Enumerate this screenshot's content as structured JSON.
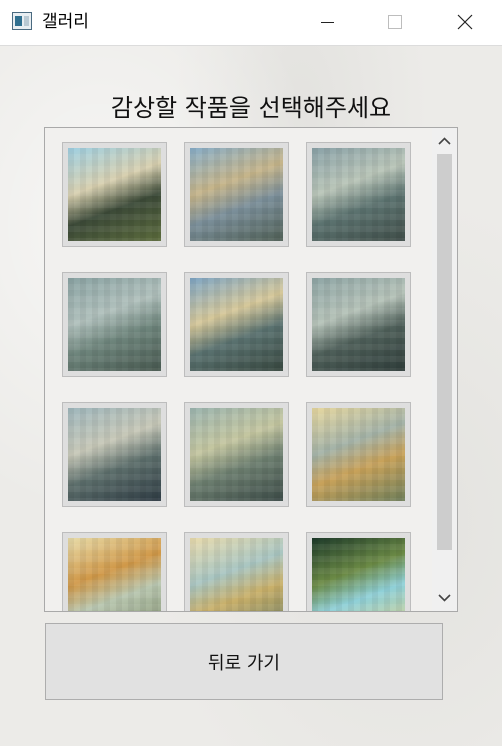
{
  "window": {
    "title": "갤러리",
    "controls": [
      "minimize-icon",
      "maximize-icon",
      "close-icon"
    ]
  },
  "heading": "감상할 작품을 선택해주세요",
  "thumbnails": [
    {
      "colors": [
        "#9fd0e2",
        "#3c4a38",
        "#d8d0b0",
        "#5b6b3c"
      ]
    },
    {
      "colors": [
        "#88aec9",
        "#7b8f9a",
        "#c6b58a",
        "#4f5f55"
      ]
    },
    {
      "colors": [
        "#8aa2a8",
        "#5c7370",
        "#b9c5b8",
        "#3f4d48"
      ]
    },
    {
      "colors": [
        "#8aa3a3",
        "#6e857c",
        "#b0c0bc",
        "#47584f"
      ]
    },
    {
      "colors": [
        "#7fa6c5",
        "#5a7270",
        "#d6c89a",
        "#37473f"
      ]
    },
    {
      "colors": [
        "#8fa6a6",
        "#4f605a",
        "#b5c2b8",
        "#2f3d3a"
      ]
    },
    {
      "colors": [
        "#9fb7bd",
        "#5d6f6c",
        "#c7c8b8",
        "#2e3b43"
      ]
    },
    {
      "colors": [
        "#9db6b1",
        "#6d7f70",
        "#c4c6a0",
        "#3c4b47"
      ]
    },
    {
      "colors": [
        "#e7d8a0",
        "#c8a25a",
        "#a4b3a8",
        "#6f7f5a"
      ]
    },
    {
      "colors": [
        "#e8dcaa",
        "#b9c7b0",
        "#d09848",
        "#7d8c6a"
      ]
    },
    {
      "colors": [
        "#eadcae",
        "#c9b06a",
        "#a9c6c2",
        "#6b7b5e"
      ]
    },
    {
      "colors": [
        "#1d3a2a",
        "#8fd0d8",
        "#6b8a45",
        "#d7d08a"
      ]
    }
  ],
  "back_button": {
    "label": "뒤로 가기"
  }
}
